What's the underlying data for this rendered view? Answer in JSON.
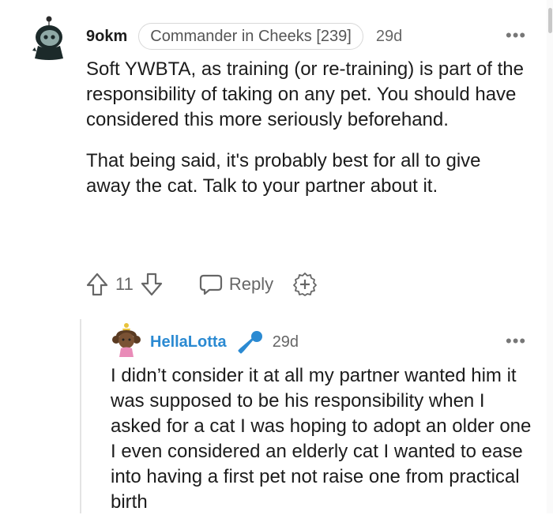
{
  "comment": {
    "username": "9okm",
    "flair": "Commander in Cheeks [239]",
    "timestamp": "29d",
    "body": [
      "Soft YWBTA, as training (or re-training) is part of the responsibility of taking on any pet. You should have considered this more seriously beforehand.",
      "That being said, it's probably best for all to give away the cat. Talk to your partner about it."
    ],
    "vote_count": "11",
    "reply_label": "Reply"
  },
  "reply": {
    "username": "HellaLotta",
    "timestamp": "29d",
    "body": "I didn’t consider it at all my partner wanted him it was supposed to be his responsibility when I asked for a cat I was hoping to adopt an older one I even considered an elderly cat I wanted to ease into having a first pet not raise one from practical birth"
  },
  "icons": {
    "upvote": "upvote-arrow-icon",
    "downvote": "downvote-arrow-icon",
    "reply": "speech-bubble-icon",
    "award": "add-award-icon",
    "more": "more-options-icon",
    "mic": "microphone-icon"
  },
  "colors": {
    "reply_username": "#2b8ad2",
    "mic_icon": "#2b8ad2",
    "avatar_dark": "#1c2a2a",
    "avatar_face": "#8fa9a6"
  }
}
